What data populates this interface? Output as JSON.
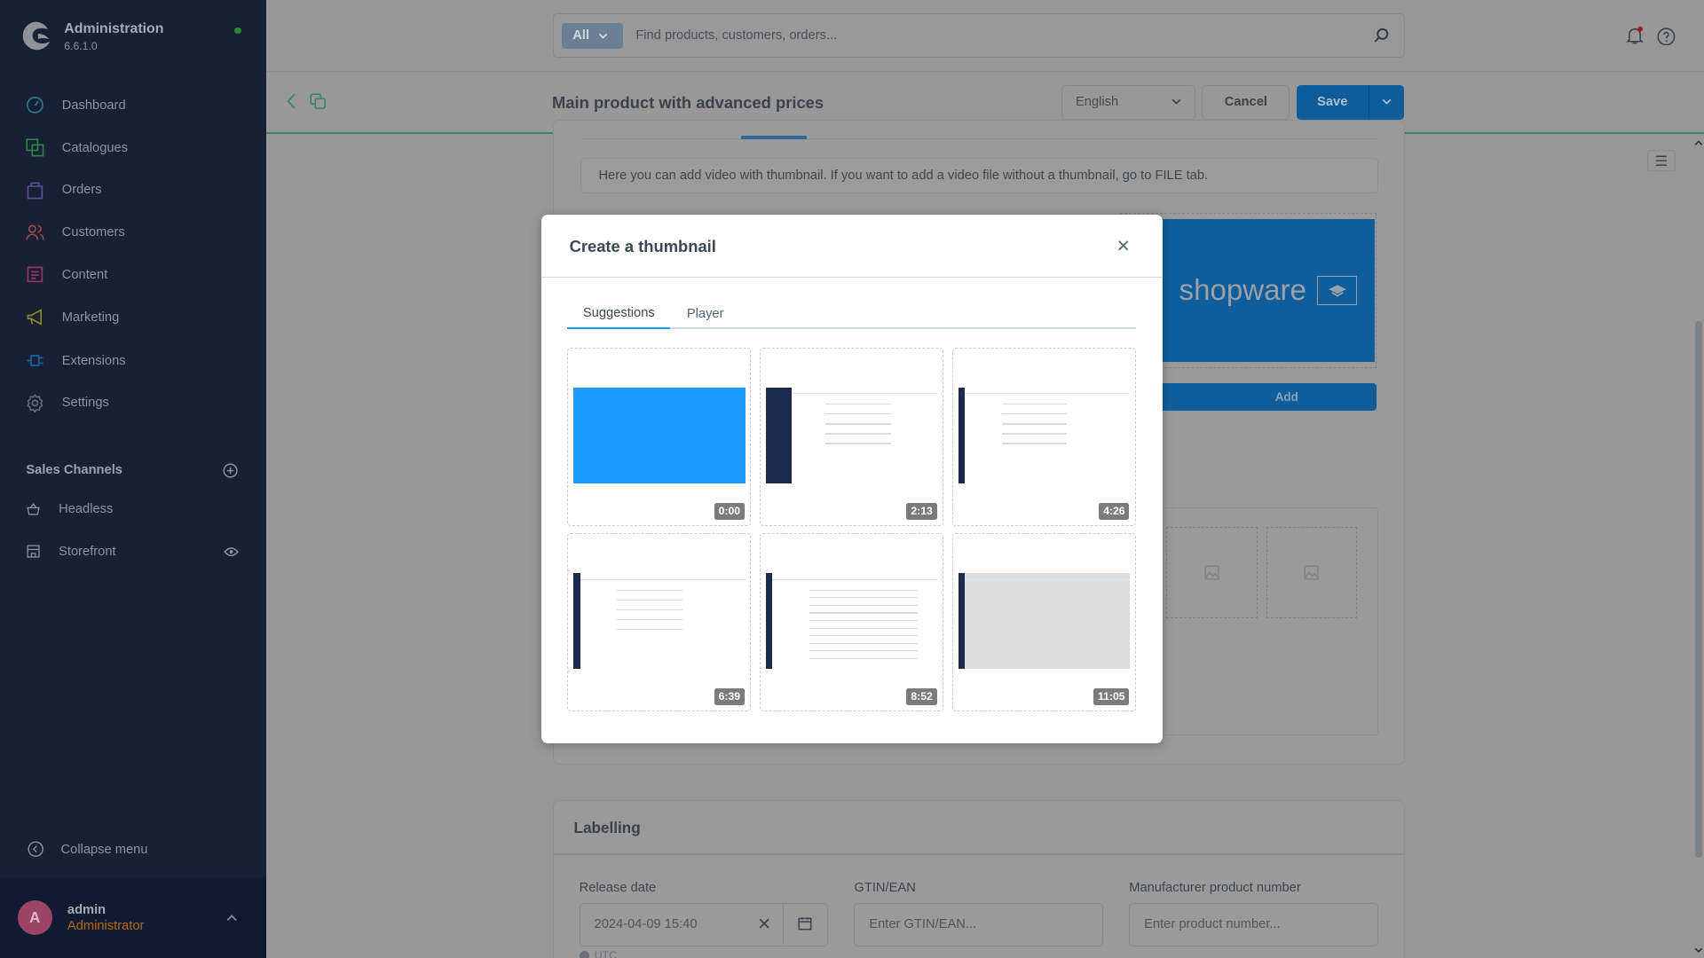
{
  "app": {
    "title": "Administration",
    "version": "6.6.1.0"
  },
  "sidebar": {
    "items": [
      {
        "label": "Dashboard",
        "icon": "dashboard-icon",
        "color": "#2f7c8f"
      },
      {
        "label": "Catalogues",
        "icon": "catalogues-icon",
        "color": "#2f8a4a"
      },
      {
        "label": "Orders",
        "icon": "orders-icon",
        "color": "#5a4f9a"
      },
      {
        "label": "Customers",
        "icon": "customers-icon",
        "color": "#a34a40"
      },
      {
        "label": "Content",
        "icon": "content-icon",
        "color": "#a3336a"
      },
      {
        "label": "Marketing",
        "icon": "marketing-icon",
        "color": "#9a8a1a"
      },
      {
        "label": "Extensions",
        "icon": "extensions-icon",
        "color": "#1a5e9a"
      },
      {
        "label": "Settings",
        "icon": "settings-icon",
        "color": "#6a7380"
      }
    ],
    "sales_channels_title": "Sales Channels",
    "sales_channels": [
      {
        "label": "Headless",
        "icon": "basket-icon"
      },
      {
        "label": "Storefront",
        "icon": "storefront-icon"
      }
    ],
    "collapse_label": "Collapse menu",
    "user": {
      "initial": "A",
      "name": "admin",
      "role": "Administrator"
    }
  },
  "search": {
    "scope": "All",
    "placeholder": "Find products, customers, orders..."
  },
  "header": {
    "title": "Main product with advanced prices",
    "language": "English",
    "cancel": "Cancel",
    "save": "Save"
  },
  "content": {
    "info": "Here you can add video with thumbnail. If you want to add a video file without a thumbnail, go to FILE tab.",
    "logo_text": "shopware",
    "add_label": "Add",
    "labelling": {
      "title": "Labelling",
      "release_label": "Release date",
      "release_value": "2024-04-09 15:40",
      "timezone": "UTC",
      "gtin_label": "GTIN/EAN",
      "gtin_placeholder": "Enter GTIN/EAN...",
      "mpn_label": "Manufacturer product number",
      "mpn_placeholder": "Enter product number..."
    }
  },
  "modal": {
    "title": "Create a thumbnail",
    "tabs": [
      {
        "label": "Suggestions",
        "active": true
      },
      {
        "label": "Player",
        "active": false
      }
    ],
    "thumbnails": [
      {
        "time": "0:00"
      },
      {
        "time": "2:13"
      },
      {
        "time": "4:26"
      },
      {
        "time": "6:39"
      },
      {
        "time": "8:52"
      },
      {
        "time": "11:05"
      }
    ]
  },
  "colors": {
    "accent": "#189eff",
    "save": "#0e5d9a",
    "sidebar": "#172034"
  }
}
